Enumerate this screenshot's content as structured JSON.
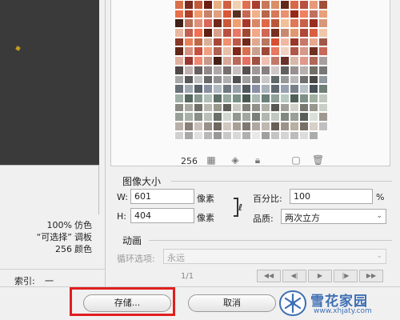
{
  "info": {
    "dither": {
      "value": "100%",
      "label": "仿色"
    },
    "palette": {
      "value": "“可选择”",
      "label": "调板"
    },
    "colors": {
      "value": "256",
      "label": "颜色"
    },
    "index_label": "索引:",
    "index_value": "一"
  },
  "color_table": {
    "count": "256",
    "swatches": [
      "#d8704a",
      "#7a2a1e",
      "#c05a3a",
      "#6b1e14",
      "#e8b080",
      "#d06040",
      "#f0d0b0",
      "#e07050",
      "#a84030",
      "#c87858",
      "#d89068",
      "#602818",
      "#d86848",
      "#b85040",
      "#e89878",
      "#a05038",
      "#e87048",
      "#b04028",
      "#f09868",
      "#c88068",
      "#e0a080",
      "#d85838",
      "#583020",
      "#c86850",
      "#f0b088",
      "#b86848",
      "#d87858",
      "#e89070",
      "#982818",
      "#f08060",
      "#c07060",
      "#e8a078",
      "#402018",
      "#b87058",
      "#e09078",
      "#d86858",
      "#702818",
      "#c85838",
      "#f0a070",
      "#a83828",
      "#d88868",
      "#e06848",
      "#b85838",
      "#f0c098",
      "#e07858",
      "#c86048",
      "#983020",
      "#d89878",
      "#e8b8a0",
      "#c06050",
      "#f07050",
      "#602010",
      "#d8a088",
      "#b85040",
      "#e87868",
      "#a04830",
      "#f0a888",
      "#d06858",
      "#783020",
      "#c88870",
      "#e09870",
      "#b04838",
      "#d86040",
      "#f0c8a8",
      "#883828",
      "#e88058",
      "#c06848",
      "#d8b098",
      "#a84838",
      "#f09070",
      "#c05848",
      "#702818",
      "#e0a890",
      "#b87860",
      "#d85030",
      "#f0b8a0",
      "#983828",
      "#c87868",
      "#e8a890",
      "#a05848",
      "#602818",
      "#d89080",
      "#c85040",
      "#f0a080",
      "#b06050",
      "#e8c0a8",
      "#802818",
      "#d87050",
      "#c8a090",
      "#a04838",
      "#e87860",
      "#f0d0c0",
      "#b05848",
      "#d89888",
      "#703020",
      "#c86858",
      "#e0b0a0",
      "#983830",
      "#f08870",
      "#c89888",
      "#482018",
      "#d8a898",
      "#b86858",
      "#e87060",
      "#a05040",
      "#f0c0b0",
      "#c07868",
      "#683028",
      "#d8b8a8",
      "#e09888",
      "#b06858",
      "#a8a0a0",
      "#504848",
      "#c0b0b0",
      "#686060",
      "#908888",
      "#b0a8a8",
      "#787070",
      "#c8c0c0",
      "#585050",
      "#a09898",
      "#888080",
      "#d0c8c8",
      "#606060",
      "#989090",
      "#b8b0b0",
      "#707068",
      "#787878",
      "#a8a8a8",
      "#585858",
      "#c0c0c0",
      "#686868",
      "#909090",
      "#b0b0b0",
      "#505050",
      "#a0a0a0",
      "#808080",
      "#c8c8c8",
      "#606868",
      "#989898",
      "#b8b8b8",
      "#707070",
      "#484848",
      "#9098a0",
      "#687078",
      "#a0a8b0",
      "#586068",
      "#8890a0",
      "#b0b8c0",
      "#707880",
      "#98a0a8",
      "#505860",
      "#8890a8",
      "#a8b0b8",
      "#606870",
      "#98a0b0",
      "#788088",
      "#b8c0c8",
      "#485058",
      "#708078",
      "#a0b0a8",
      "#586860",
      "#889890",
      "#b0c0b8",
      "#607068",
      "#98a8a0",
      "#789088",
      "#485850",
      "#a8b8b0",
      "#688078",
      "#90a098",
      "#b8c8c0",
      "#506058",
      "#809088",
      "#a0b0a0",
      "#c0c8c0",
      "#8c8c84",
      "#a8a8a0",
      "#707068",
      "#b8b8b0",
      "#98988c",
      "#606058",
      "#c8c8c0",
      "#808078",
      "#909088",
      "#b0b0a8",
      "#585850",
      "#a0a098",
      "#d0d0c8",
      "#787870",
      "#989890",
      "#c8d0c8",
      "#98a098",
      "#a8b0a8",
      "#889088",
      "#b8c0b8",
      "#687068",
      "#d0d8d0",
      "#909890",
      "#a0a8a0",
      "#788078",
      "#b0b8b0",
      "#c0c8c0",
      "#808880",
      "#98a098",
      "#586058",
      "#d8e0d8",
      "#a09890",
      "#b8b0a8",
      "#888078",
      "#c8c0b8",
      "#989088",
      "#706860",
      "#d0c8c0",
      "#a8a098",
      "#807870",
      "#b0a8a0",
      "#c0b8b0",
      "#686058",
      "#9c948c",
      "#b8b0a0",
      "#787068",
      "#d8d0c8",
      "#c0c0c0",
      "#d0d0d0",
      "#a8a8a8",
      "#e0e0e0",
      "#b8b8b8",
      "#989898",
      "#c8c8c8",
      "#d8d8d8",
      "#b0b0b0",
      "#e8e8e8",
      "#a0a0a0",
      "#c4c4c4",
      "#d4d4d4",
      "#bcbcbc",
      "#dcdcdc",
      "#acacac"
    ]
  },
  "image_size": {
    "title": "图像大小",
    "width_label": "W:",
    "width_value": "601",
    "width_unit": "像素",
    "height_label": "H:",
    "height_value": "404",
    "height_unit": "像素",
    "percent_label": "百分比:",
    "percent_value": "100",
    "percent_unit": "%",
    "quality_label": "品质:",
    "quality_value": "两次立方"
  },
  "animation": {
    "title": "动画",
    "loop_label": "循环选项:",
    "loop_value": "永远",
    "frame_counter": "1/1"
  },
  "buttons": {
    "save": "存储...",
    "cancel": "取消"
  },
  "watermark": {
    "title": "雪花家园",
    "url": "www.xhjaty.com"
  },
  "colors": {
    "highlight": "#e21e1e",
    "watermark": "#3f6fb4"
  }
}
